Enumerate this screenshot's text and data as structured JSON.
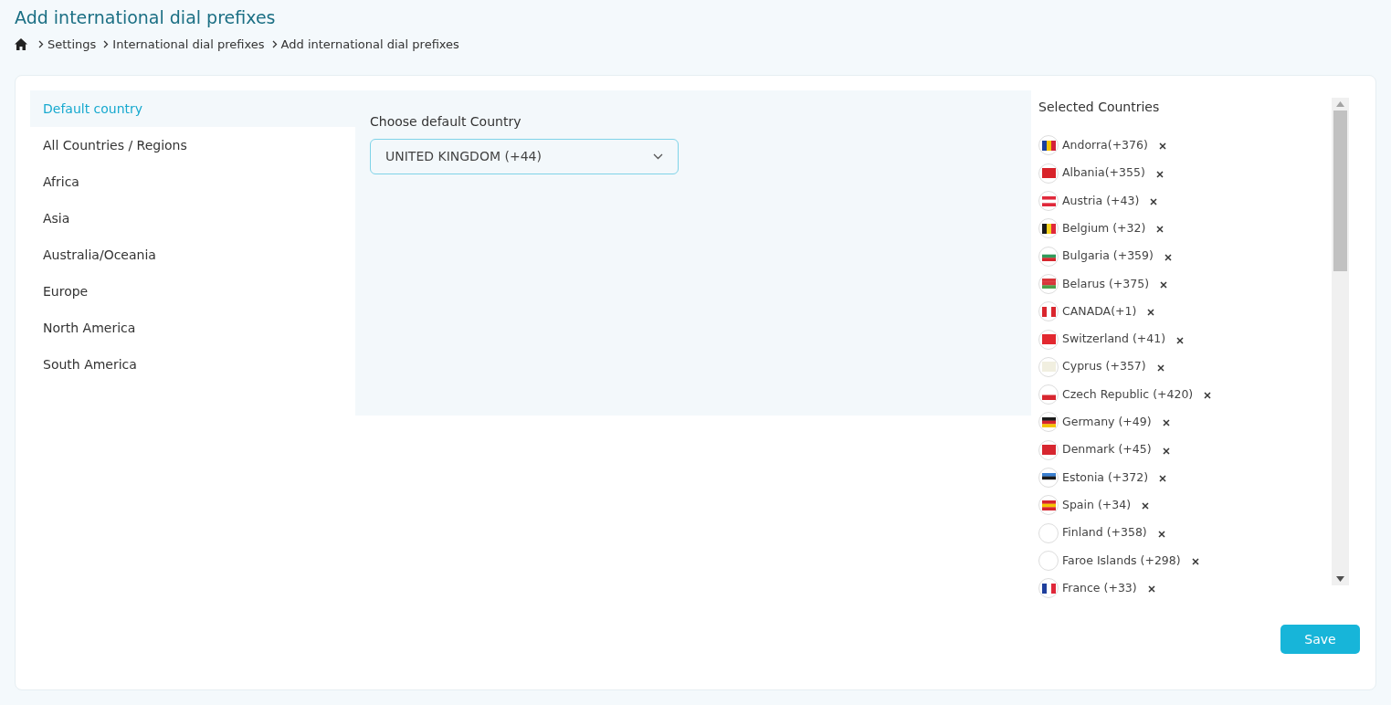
{
  "page_title": "Add international dial prefixes",
  "breadcrumb": [
    "Settings",
    "International dial prefixes",
    "Add international dial prefixes"
  ],
  "sidebar": {
    "items": [
      {
        "label": "Default country",
        "selected": true
      },
      {
        "label": "All Countries / Regions",
        "selected": false
      },
      {
        "label": "Africa",
        "selected": false
      },
      {
        "label": "Asia",
        "selected": false
      },
      {
        "label": "Australia/Oceania",
        "selected": false
      },
      {
        "label": "Europe",
        "selected": false
      },
      {
        "label": "North America",
        "selected": false
      },
      {
        "label": "South America",
        "selected": false
      }
    ]
  },
  "default_country": {
    "label": "Choose default Country",
    "value": "UNITED KINGDOM (+44)"
  },
  "selected_countries": {
    "title": "Selected Countries",
    "items": [
      {
        "name": "Andorra(+376)"
      },
      {
        "name": "Albania(+355)"
      },
      {
        "name": "Austria (+43)"
      },
      {
        "name": "Belgium (+32)"
      },
      {
        "name": "Bulgaria (+359)"
      },
      {
        "name": "Belarus (+375)"
      },
      {
        "name": "CANADA(+1)"
      },
      {
        "name": "Switzerland (+41)"
      },
      {
        "name": "Cyprus (+357)"
      },
      {
        "name": "Czech Republic (+420)"
      },
      {
        "name": "Germany (+49)"
      },
      {
        "name": "Denmark (+45)"
      },
      {
        "name": "Estonia (+372)"
      },
      {
        "name": "Spain (+34)"
      },
      {
        "name": "Finland (+358)"
      },
      {
        "name": "Faroe Islands (+298)"
      },
      {
        "name": "France (+33)"
      }
    ]
  },
  "save_button": "Save"
}
